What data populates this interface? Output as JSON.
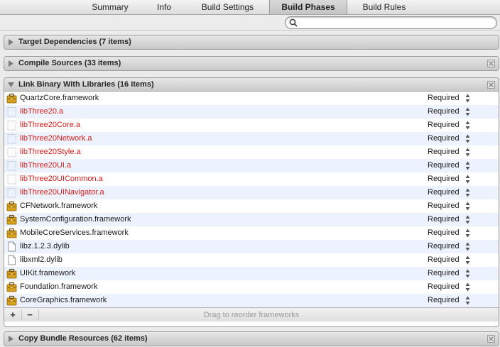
{
  "tabs": [
    {
      "label": "Summary",
      "active": false
    },
    {
      "label": "Info",
      "active": false
    },
    {
      "label": "Build Settings",
      "active": false
    },
    {
      "label": "Build Phases",
      "active": true
    },
    {
      "label": "Build Rules",
      "active": false
    }
  ],
  "search": {
    "value": "",
    "placeholder": ""
  },
  "sections": {
    "target_dependencies": {
      "title": "Target Dependencies (7 items)",
      "expanded": false,
      "closable": false
    },
    "compile_sources": {
      "title": "Compile Sources (33 items)",
      "expanded": false,
      "closable": true
    },
    "link_binary": {
      "title": "Link Binary With Libraries (16 items)",
      "expanded": true,
      "closable": true,
      "items": [
        {
          "name": "QuartzCore.framework",
          "kind": "framework",
          "status": "Required",
          "missing": false
        },
        {
          "name": "libThree20.a",
          "kind": "missing",
          "status": "Required",
          "missing": true
        },
        {
          "name": "libThree20Core.a",
          "kind": "missing",
          "status": "Required",
          "missing": true
        },
        {
          "name": "libThree20Network.a",
          "kind": "missing",
          "status": "Required",
          "missing": true
        },
        {
          "name": "libThree20Style.a",
          "kind": "missing",
          "status": "Required",
          "missing": true
        },
        {
          "name": "libThree20UI.a",
          "kind": "missing",
          "status": "Required",
          "missing": true
        },
        {
          "name": "libThree20UICommon.a",
          "kind": "missing",
          "status": "Required",
          "missing": true
        },
        {
          "name": "libThree20UINavigator.a",
          "kind": "missing",
          "status": "Required",
          "missing": true
        },
        {
          "name": "CFNetwork.framework",
          "kind": "framework",
          "status": "Required",
          "missing": false
        },
        {
          "name": "SystemConfiguration.framework",
          "kind": "framework",
          "status": "Required",
          "missing": false
        },
        {
          "name": "MobileCoreServices.framework",
          "kind": "framework",
          "status": "Required",
          "missing": false
        },
        {
          "name": "libz.1.2.3.dylib",
          "kind": "dylib",
          "status": "Required",
          "missing": false
        },
        {
          "name": "libxml2.dylib",
          "kind": "dylib",
          "status": "Required",
          "missing": false
        },
        {
          "name": "UIKit.framework",
          "kind": "framework",
          "status": "Required",
          "missing": false
        },
        {
          "name": "Foundation.framework",
          "kind": "framework",
          "status": "Required",
          "missing": false
        },
        {
          "name": "CoreGraphics.framework",
          "kind": "framework",
          "status": "Required",
          "missing": false
        }
      ],
      "footer": {
        "add_label": "+",
        "remove_label": "−",
        "hint": "Drag to reorder frameworks"
      }
    },
    "copy_bundle": {
      "title": "Copy Bundle Resources (62 items)",
      "expanded": false,
      "closable": true
    }
  },
  "colors": {
    "missing_text": "#d31d1d",
    "alt_row": "#edf3fe",
    "framework_icon": "#d9a21b"
  }
}
